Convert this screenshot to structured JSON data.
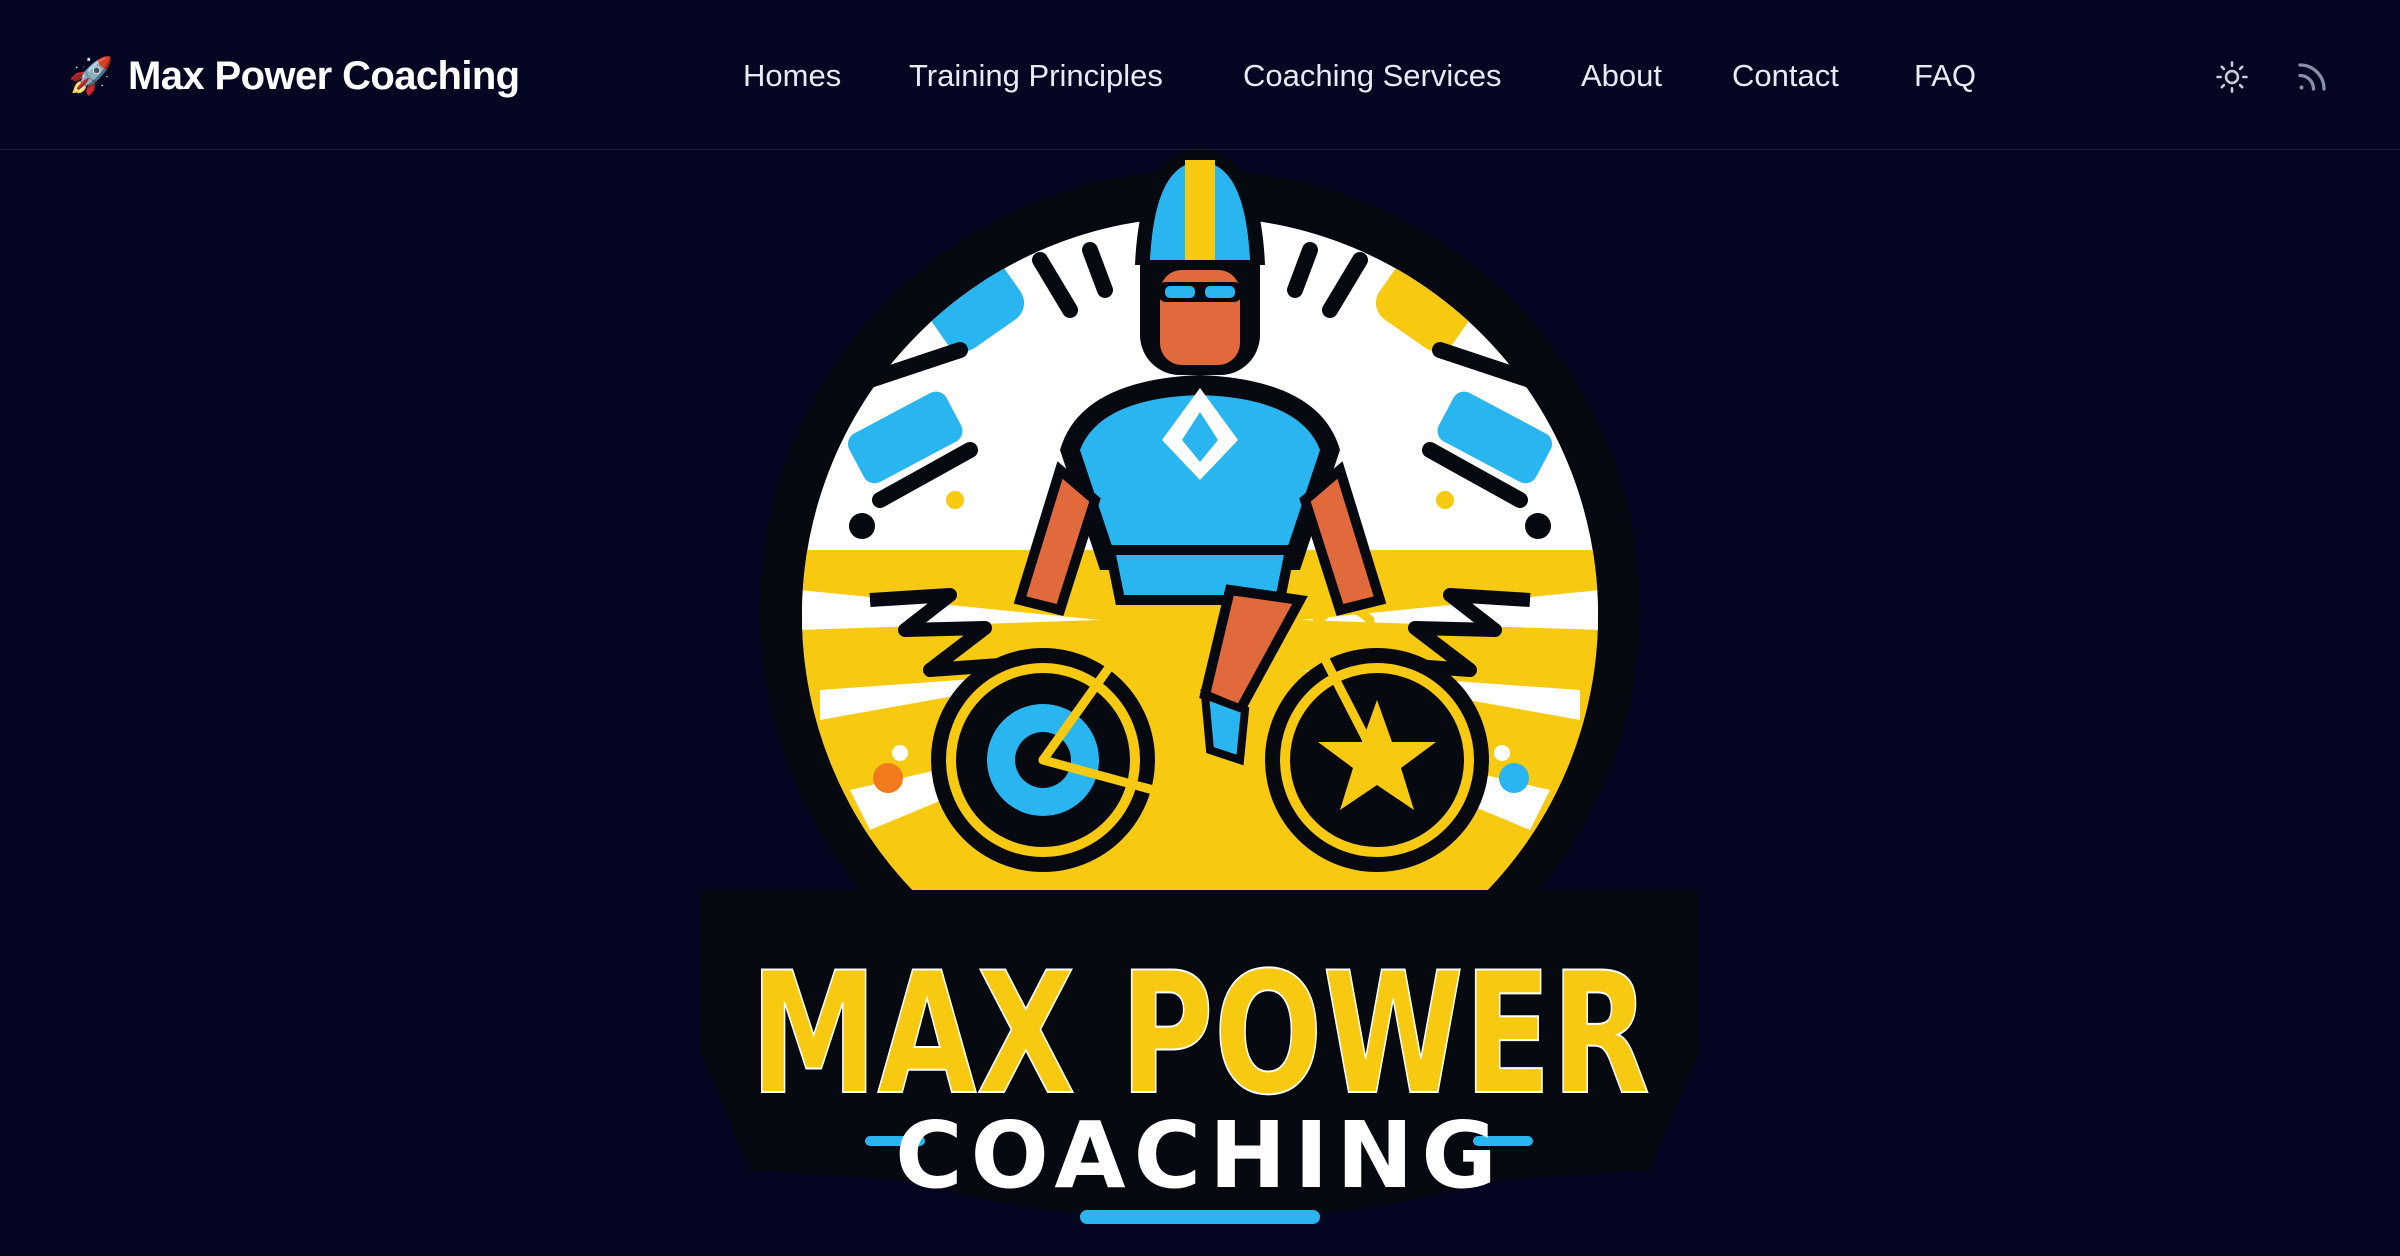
{
  "brand": {
    "emoji": "🚀",
    "name": "Max Power Coaching"
  },
  "nav": {
    "items": [
      {
        "label": "Homes"
      },
      {
        "label": "Training Principles"
      },
      {
        "label": "Coaching Services"
      },
      {
        "label": "About"
      },
      {
        "label": "Contact"
      },
      {
        "label": "FAQ"
      }
    ]
  },
  "toolbar": {
    "theme_icon": "sun-icon",
    "rss_icon": "rss-icon"
  },
  "hero": {
    "logo": {
      "title": "MAX POWER",
      "subtitle": "COACHING"
    }
  },
  "colors": {
    "background": "#040622",
    "yellow": "#f7c910",
    "cyan": "#29b6f0",
    "skin": "#e06a3c",
    "white": "#ffffff"
  }
}
